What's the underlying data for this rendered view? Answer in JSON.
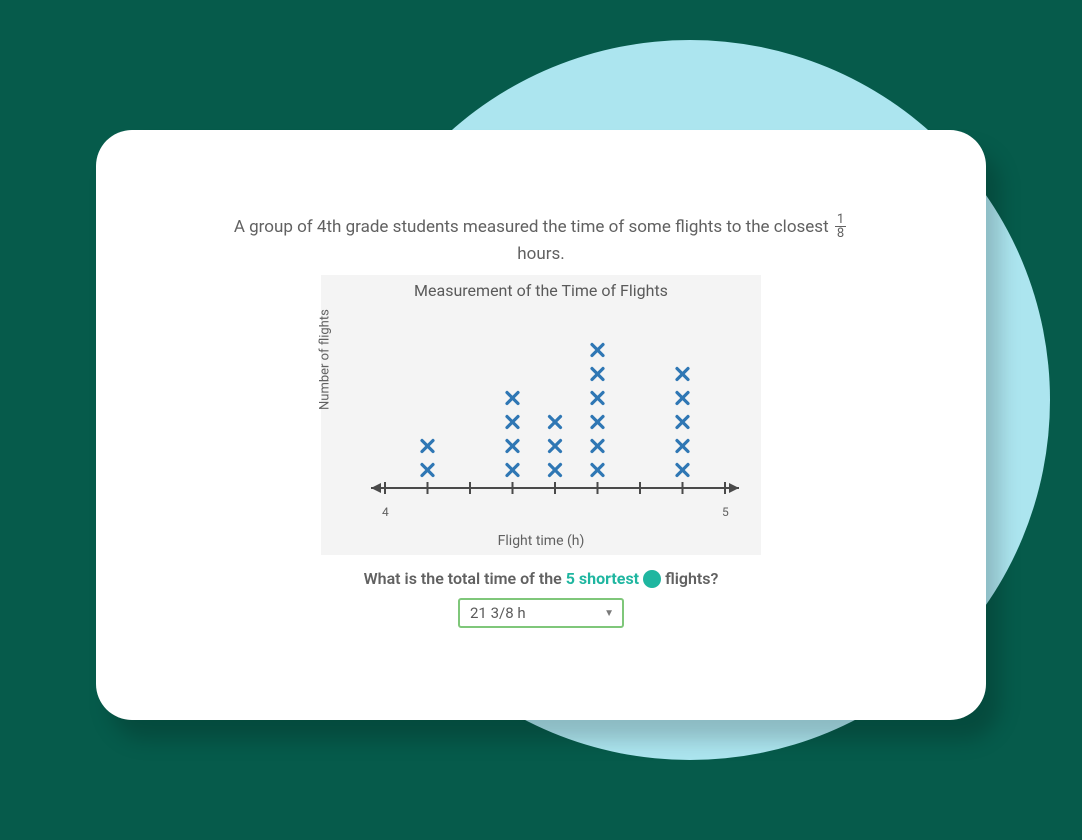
{
  "intro": {
    "part1": "A group of 4th grade students measured the time of some flights to the closest ",
    "frac_num": "1",
    "frac_den": "8",
    "part2": " hours."
  },
  "chart_data": {
    "type": "dot-plot",
    "title": "Measurement of the Time of Flights",
    "xlabel": "Flight time (h)",
    "ylabel": "Number of flights",
    "x_range": [
      4,
      5
    ],
    "x_tick_interval_eighths": 1,
    "x_tick_labels": {
      "start": "4",
      "end": "5"
    },
    "categories_eighths": [
      1,
      3,
      4,
      5,
      7
    ],
    "values": [
      2,
      4,
      3,
      6,
      5
    ],
    "marker": "x",
    "marker_color": "#2f77b4"
  },
  "question": {
    "q_prefix": "What is the total time of the ",
    "q_highlight": "5 shortest",
    "q_suffix": " flights?"
  },
  "answer": {
    "selected": "21 3/8 h"
  },
  "colors": {
    "accent": "#1fb6a0",
    "select_border": "#7fc77a",
    "marker": "#2f77b4",
    "bg_circle": "#ace5ef",
    "page_bg": "#065b4b"
  }
}
